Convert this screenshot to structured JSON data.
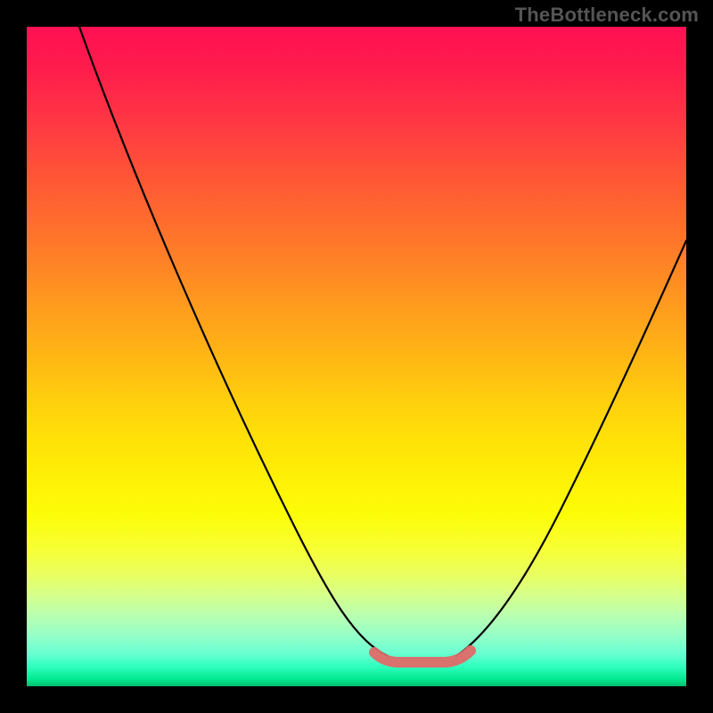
{
  "attribution": {
    "watermark": "TheBottleneck.com"
  },
  "chart_data": {
    "type": "line",
    "title": "",
    "xlabel": "",
    "ylabel": "",
    "xlim": [
      0,
      100
    ],
    "ylim": [
      0,
      100
    ],
    "grid": false,
    "legend": false,
    "background": "vertical gradient red→yellow→green (top→bottom)",
    "series": [
      {
        "name": "curve-left",
        "x": [
          8,
          12,
          18,
          24,
          30,
          36,
          42,
          46,
          50,
          53,
          55
        ],
        "values": [
          100,
          90,
          76,
          62,
          48,
          35,
          23,
          14,
          8,
          5,
          4.5
        ]
      },
      {
        "name": "curve-right",
        "x": [
          65,
          68,
          72,
          76,
          80,
          84,
          88,
          92,
          96,
          100
        ],
        "values": [
          4.5,
          6,
          10,
          16,
          24,
          33,
          42,
          51,
          60,
          68
        ]
      },
      {
        "name": "bottom-highlight",
        "x": [
          53,
          55,
          57,
          59,
          61,
          63,
          65,
          67
        ],
        "values": [
          5.2,
          4.6,
          4.2,
          4.0,
          4.0,
          4.2,
          4.7,
          5.5
        ]
      }
    ],
    "annotations": [
      {
        "text": "TheBottleneck.com",
        "position": "top-right",
        "role": "watermark"
      }
    ]
  }
}
